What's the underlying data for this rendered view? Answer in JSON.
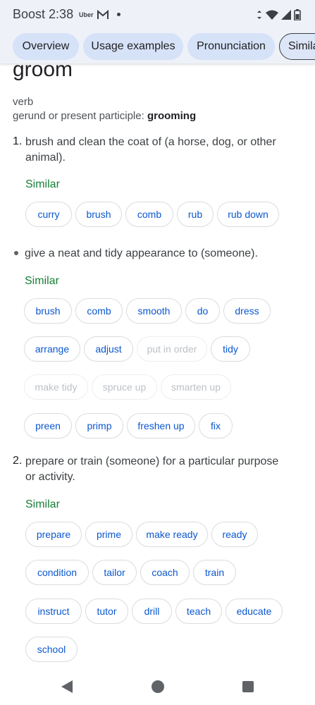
{
  "status": {
    "carrier": "Boost",
    "time": "2:38",
    "uber_label": "Uber"
  },
  "tabs": [
    {
      "label": "Overview"
    },
    {
      "label": "Usage examples"
    },
    {
      "label": "Pronunciation"
    },
    {
      "label": "Simila"
    }
  ],
  "entry": {
    "word": "groom",
    "pos": "verb",
    "gerund_prefix": "gerund or present participle: ",
    "gerund": "grooming"
  },
  "senses": [
    {
      "number": "1.",
      "definition": "brush and clean the coat of (a horse, dog, or other animal).",
      "similar_label": "Similar",
      "chips": [
        "curry",
        "brush",
        "comb",
        "rub",
        "rub down"
      ]
    },
    {
      "definition": "give a neat and tidy appearance to (someone).",
      "similar_label": "Similar",
      "chips": [
        "brush",
        "comb",
        "smooth",
        "do",
        "dress",
        "arrange",
        "adjust",
        "put in order",
        "tidy",
        "make tidy",
        "spruce up",
        "smarten up",
        "preen",
        "primp",
        "freshen up",
        "fix"
      ]
    },
    {
      "number": "2.",
      "definition": "prepare or train (someone) for a particular purpose or activity.",
      "similar_label": "Similar",
      "chips": [
        "prepare",
        "prime",
        "make ready",
        "ready",
        "condition",
        "tailor",
        "coach",
        "train",
        "instruct",
        "tutor",
        "drill",
        "teach",
        "educate",
        "school"
      ]
    }
  ],
  "colors": {
    "chip_text": "#0b57d0",
    "similar": "#188038",
    "chip_disabled": "#bdc1c6",
    "tab_bg": "#d6e2f8",
    "header_bg": "#eef1f8"
  },
  "icons": [
    "gmail-icon",
    "vibrate-icon",
    "wifi-icon",
    "signal-icon",
    "battery-icon",
    "back-icon",
    "home-icon",
    "recents-icon"
  ]
}
